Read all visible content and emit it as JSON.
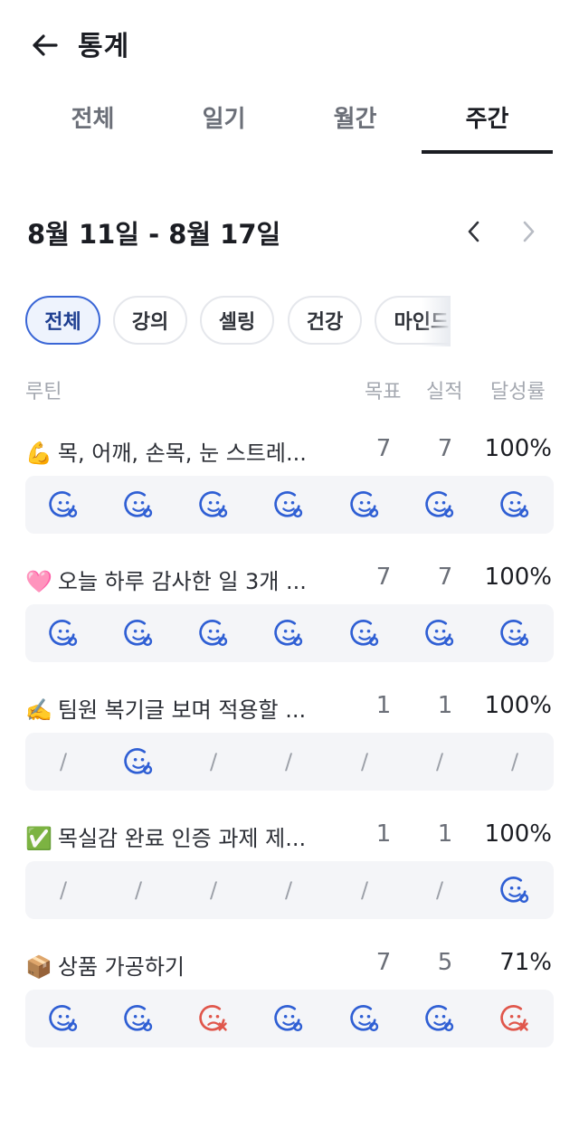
{
  "header": {
    "title": "통계"
  },
  "tabs": [
    {
      "label": "전체",
      "active": false
    },
    {
      "label": "일기",
      "active": false
    },
    {
      "label": "월간",
      "active": false
    },
    {
      "label": "주간",
      "active": true
    }
  ],
  "week": {
    "label": "8월 11일 - 8월 17일"
  },
  "chips": [
    {
      "label": "전체",
      "active": true
    },
    {
      "label": "강의",
      "active": false
    },
    {
      "label": "셀링",
      "active": false
    },
    {
      "label": "건강",
      "active": false
    },
    {
      "label": "마인드셋",
      "active": false
    }
  ],
  "columns": {
    "routine": "루틴",
    "goal": "목표",
    "actual": "실적",
    "rate": "달성률"
  },
  "colors": {
    "success": "#2f5fd4",
    "fail": "#e0564b",
    "active_chip_border": "#3a66d6"
  },
  "routines": [
    {
      "emoji": "💪",
      "name": "목, 어깨, 손목, 눈 스트레...",
      "goal": "7",
      "actual": "7",
      "rate": "100%",
      "days": [
        "success",
        "success",
        "success",
        "success",
        "success",
        "success",
        "success"
      ]
    },
    {
      "emoji": "🩷",
      "name": "오늘 하루 감사한 일 3개 ...",
      "goal": "7",
      "actual": "7",
      "rate": "100%",
      "days": [
        "success",
        "success",
        "success",
        "success",
        "success",
        "success",
        "success"
      ]
    },
    {
      "emoji": "✍️",
      "name": "팀원 복기글 보며 적용할 ...",
      "goal": "1",
      "actual": "1",
      "rate": "100%",
      "days": [
        "none",
        "success",
        "none",
        "none",
        "none",
        "none",
        "none"
      ]
    },
    {
      "emoji": "✅",
      "name": "목실감 완료 인증 과제 제...",
      "goal": "1",
      "actual": "1",
      "rate": "100%",
      "days": [
        "none",
        "none",
        "none",
        "none",
        "none",
        "none",
        "success"
      ]
    },
    {
      "emoji": "📦",
      "name": "상품 가공하기",
      "goal": "7",
      "actual": "5",
      "rate": "71%",
      "days": [
        "success",
        "success",
        "fail",
        "success",
        "success",
        "success",
        "fail"
      ]
    }
  ]
}
